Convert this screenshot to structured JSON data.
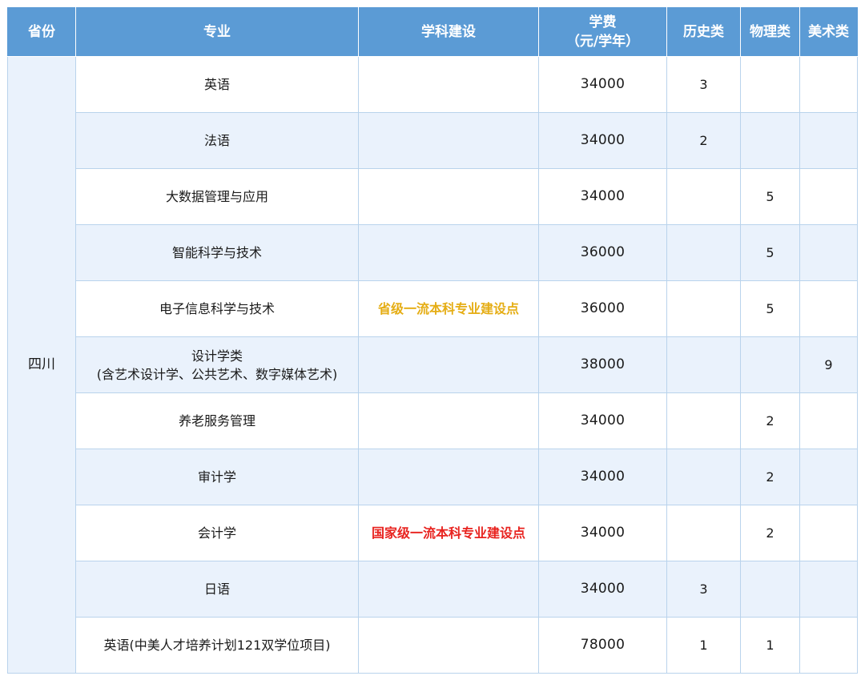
{
  "headers": {
    "province": "省份",
    "major": "专业",
    "discipline": "学科建设",
    "fee_line1": "学费",
    "fee_line2": "（元/学年）",
    "history": "历史类",
    "physics": "物理类",
    "art": "美术类"
  },
  "province": "四川",
  "rows": [
    {
      "major_line1": "英语",
      "major_line2": "",
      "discipline": "",
      "discipline_level": "",
      "fee": "34000",
      "history": "3",
      "physics": "",
      "art": ""
    },
    {
      "major_line1": "法语",
      "major_line2": "",
      "discipline": "",
      "discipline_level": "",
      "fee": "34000",
      "history": "2",
      "physics": "",
      "art": ""
    },
    {
      "major_line1": "大数据管理与应用",
      "major_line2": "",
      "discipline": "",
      "discipline_level": "",
      "fee": "34000",
      "history": "",
      "physics": "5",
      "art": ""
    },
    {
      "major_line1": "智能科学与技术",
      "major_line2": "",
      "discipline": "",
      "discipline_level": "",
      "fee": "36000",
      "history": "",
      "physics": "5",
      "art": ""
    },
    {
      "major_line1": "电子信息科学与技术",
      "major_line2": "",
      "discipline": "省级一流本科专业建设点",
      "discipline_level": "provincial",
      "fee": "36000",
      "history": "",
      "physics": "5",
      "art": ""
    },
    {
      "major_line1": "设计学类",
      "major_line2": "(含艺术设计学、公共艺术、数字媒体艺术)",
      "discipline": "",
      "discipline_level": "",
      "fee": "38000",
      "history": "",
      "physics": "",
      "art": "9"
    },
    {
      "major_line1": "养老服务管理",
      "major_line2": "",
      "discipline": "",
      "discipline_level": "",
      "fee": "34000",
      "history": "",
      "physics": "2",
      "art": ""
    },
    {
      "major_line1": "审计学",
      "major_line2": "",
      "discipline": "",
      "discipline_level": "",
      "fee": "34000",
      "history": "",
      "physics": "2",
      "art": ""
    },
    {
      "major_line1": "会计学",
      "major_line2": "",
      "discipline": "国家级一流本科专业建设点",
      "discipline_level": "national",
      "fee": "34000",
      "history": "",
      "physics": "2",
      "art": ""
    },
    {
      "major_line1": "日语",
      "major_line2": "",
      "discipline": "",
      "discipline_level": "",
      "fee": "34000",
      "history": "3",
      "physics": "",
      "art": ""
    },
    {
      "major_line1": "英语(中美人才培养计划121双学位项目)",
      "major_line2": "",
      "discipline": "",
      "discipline_level": "",
      "fee": "78000",
      "history": "1",
      "physics": "1",
      "art": ""
    }
  ],
  "colors": {
    "header_bg": "#5b9bd5",
    "row_alt_bg": "#eaf2fc",
    "provincial_text": "#e5ad14",
    "national_text": "#e8231f"
  }
}
